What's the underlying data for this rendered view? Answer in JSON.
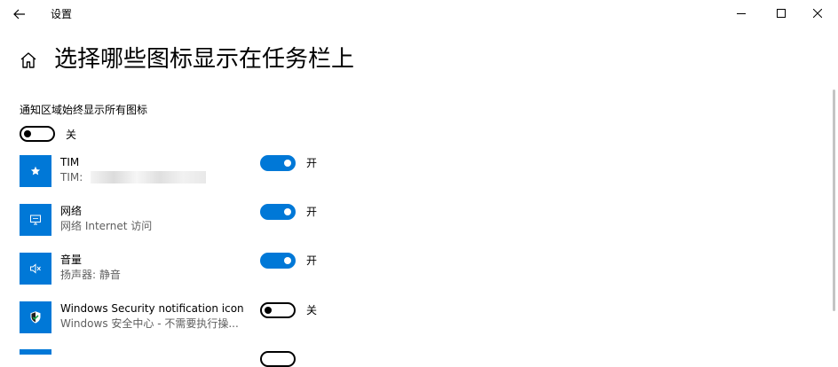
{
  "window": {
    "title": "设置",
    "minimize_icon": "minimize-icon",
    "maximize_icon": "maximize-icon",
    "close_icon": "close-icon"
  },
  "header": {
    "title": "选择哪些图标显示在任务栏上",
    "home_icon": "home-icon",
    "back_icon": "back-arrow-icon"
  },
  "always_show": {
    "label": "通知区域始终显示所有图标",
    "state": "关",
    "on": false
  },
  "items": [
    {
      "name": "TIM",
      "desc": "TIM: ",
      "state": "开",
      "on": true,
      "icon": "star-icon",
      "tile_color": "#0078d7"
    },
    {
      "name": "网络",
      "desc": "网络 Internet 访问",
      "state": "开",
      "on": true,
      "icon": "network-monitor-icon",
      "tile_color": "#0078d7"
    },
    {
      "name": "音量",
      "desc": "扬声器: 静音",
      "state": "开",
      "on": true,
      "icon": "speaker-muted-icon",
      "tile_color": "#0078d7"
    },
    {
      "name": "Windows Security notification icon",
      "desc": "Windows 安全中心 - 不需要执行操...",
      "state": "关",
      "on": false,
      "icon": "shield-check-icon",
      "tile_color": "#0078d7"
    }
  ],
  "colors": {
    "accent": "#0078d7"
  }
}
